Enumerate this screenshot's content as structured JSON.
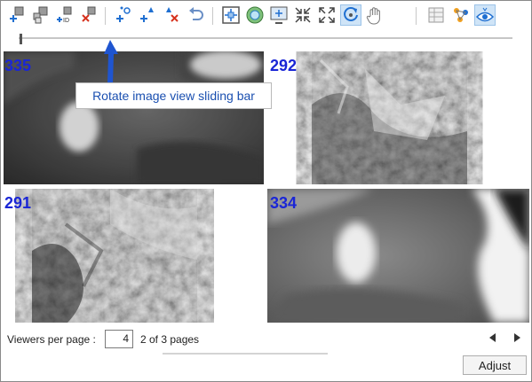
{
  "toolbar": {
    "tools": [
      {
        "icon": "add-point-icon"
      },
      {
        "icon": "add-multiple-points-icon"
      },
      {
        "icon": "add-point-by-id-icon"
      },
      {
        "icon": "delete-point-icon"
      },
      {
        "icon": "add-tie-point-icon"
      },
      {
        "icon": "add-control-point-icon"
      },
      {
        "icon": "delete-tie-point-icon"
      },
      {
        "icon": "undo-icon"
      },
      {
        "icon": "fit-extent-icon"
      },
      {
        "icon": "globe-icon"
      },
      {
        "icon": "center-view-icon"
      },
      {
        "icon": "zoom-in-collapse-icon"
      },
      {
        "icon": "zoom-out-expand-icon"
      },
      {
        "icon": "rotate-view-icon",
        "active": true
      },
      {
        "icon": "pan-hand-icon"
      },
      {
        "icon": "display-table-icon"
      },
      {
        "icon": "point-cluster-icon"
      },
      {
        "icon": "show-points-eye-icon",
        "active": true
      }
    ]
  },
  "slider": {
    "value": 0
  },
  "viewers": [
    {
      "number": "335"
    },
    {
      "number": "292"
    },
    {
      "number": "291"
    },
    {
      "number": "334"
    }
  ],
  "callout": {
    "text": "Rotate image view sliding bar"
  },
  "footer": {
    "viewers_per_page_label": "Viewers per page :",
    "viewers_per_page_value": "4",
    "page_status": "2 of 3 pages",
    "adjust_label": "Adjust"
  },
  "colors": {
    "accent": "#1a26d6",
    "callout_text": "#1a4fb0",
    "arrow": "#1f55d0",
    "active_tool": "#cfe4f7"
  }
}
